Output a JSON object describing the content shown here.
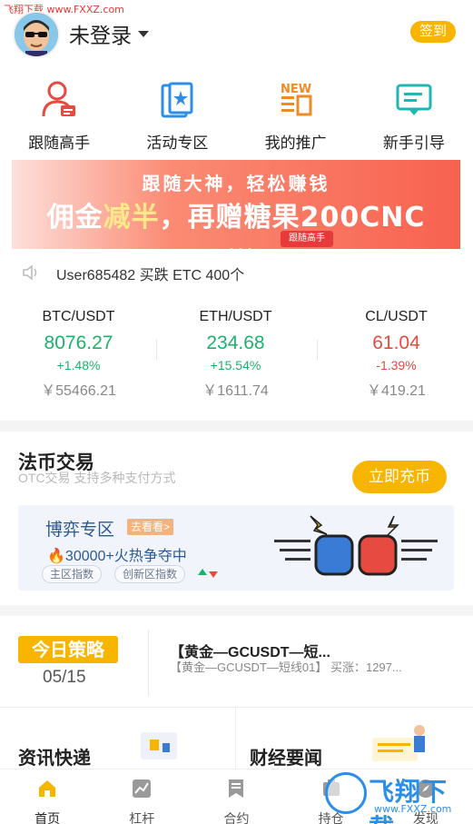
{
  "watermark": {
    "top_text": "飞翔下载 www.FXXZ.com",
    "brand": "飞翔下载",
    "url": "www.FXXZ.com"
  },
  "header": {
    "username": "未登录",
    "signin_label": "签到"
  },
  "quick_entries": [
    {
      "label": "跟随高手",
      "icon": "follow-expert-icon"
    },
    {
      "label": "活动专区",
      "icon": "events-icon"
    },
    {
      "label": "我的推广",
      "icon": "promotion-new-icon"
    },
    {
      "label": "新手引导",
      "icon": "guide-icon"
    }
  ],
  "banner": {
    "line1": "跟随大神，轻松赚钱",
    "line2_a": "佣金",
    "line2_highlight": "减半",
    "line2_b": "，再赠糖果200CNC",
    "tag": "跟随高手"
  },
  "notice": {
    "text": "User685482 买跌 ETC 400个"
  },
  "tickers": [
    {
      "pair": "BTC/USDT",
      "price": "8076.27",
      "change": "+1.48%",
      "cny": "￥55466.21",
      "direction": "up"
    },
    {
      "pair": "ETH/USDT",
      "price": "234.68",
      "change": "+15.54%",
      "cny": "￥1611.74",
      "direction": "up"
    },
    {
      "pair": "CL/USDT",
      "price": "61.04",
      "change": "-1.39%",
      "cny": "￥419.21",
      "direction": "down"
    }
  ],
  "fiat": {
    "title": "法币交易",
    "subtitle": "OTC交易 支持多种支付方式",
    "button": "立即充币"
  },
  "game": {
    "title": "博弈专区",
    "tag": "去看看>",
    "hot": "30000+火热争夺中",
    "chips": [
      "主区指数",
      "创新区指数"
    ]
  },
  "strategy": {
    "logo": "今日策略",
    "date": "05/15",
    "title": "【黄金—GCUSDT—短...",
    "desc": "【黄金—GCUSDT—短线01】 买涨：1297..."
  },
  "news": [
    {
      "title": "资讯快递"
    },
    {
      "title": "财经要闻"
    }
  ],
  "bottom_nav": [
    {
      "label": "首页",
      "icon": "home-icon",
      "active": true
    },
    {
      "label": "杠杆",
      "icon": "leverage-chart-icon",
      "active": false
    },
    {
      "label": "合约",
      "icon": "contract-icon",
      "active": false
    },
    {
      "label": "持仓",
      "icon": "positions-icon",
      "active": false
    },
    {
      "label": "发现",
      "icon": "discover-icon",
      "active": false
    }
  ],
  "colors": {
    "accent": "#f7b500",
    "up": "#1bb36b",
    "down": "#e64a40",
    "link": "#2c5a95"
  }
}
